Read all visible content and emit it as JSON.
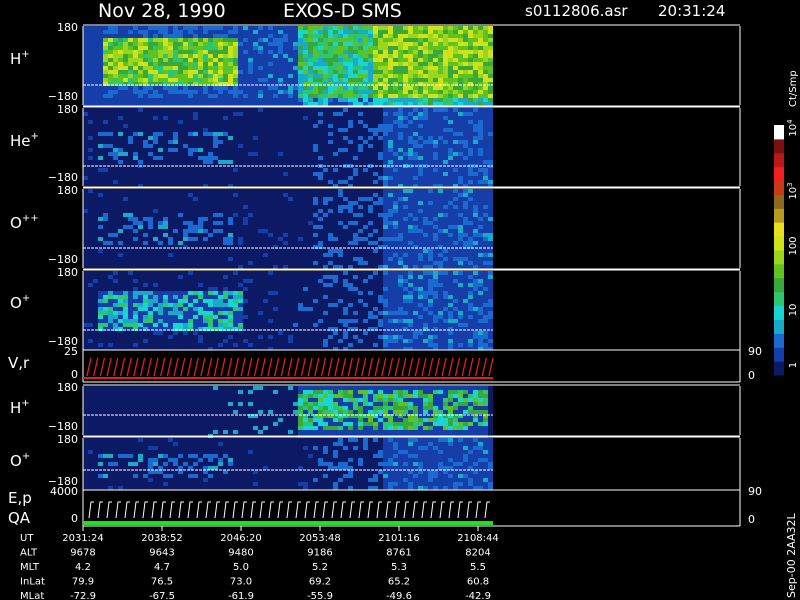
{
  "header": {
    "date": "Nov 28, 1990",
    "instrument": "EXOS-D SMS",
    "file": "s0112806.asr",
    "time": "20:31:24"
  },
  "footer_id": "Sep-00 2AA32L",
  "colors": {
    "background": "#000000",
    "panel_bg": "#102a7a",
    "frame": "#ffffff",
    "velocity_trace": "#e02020",
    "qa_trace": "#20e020"
  },
  "chart_data": {
    "type": "heatmap",
    "x_unit": "UT",
    "panels": [
      {
        "id": "h_plus_1",
        "label": "H",
        "sup": "+",
        "ytop": "180",
        "ybottom": "−180",
        "activity": "strong"
      },
      {
        "id": "he_plus",
        "label": "He",
        "sup": "+",
        "ytop": "180",
        "ybottom": "−180",
        "activity": "weak"
      },
      {
        "id": "o_pp",
        "label": "O",
        "sup": "++",
        "ytop": "180",
        "ybottom": "−180",
        "activity": "weak"
      },
      {
        "id": "o_plus_1",
        "label": "O",
        "sup": "+",
        "ytop": "180",
        "ybottom": "−180",
        "activity": "medium"
      },
      {
        "id": "h_plus_2",
        "label": "H",
        "sup": "+",
        "ytop": "180",
        "ybottom": "−180",
        "activity": "late"
      },
      {
        "id": "o_plus_2",
        "label": "O",
        "sup": "+",
        "ytop": "180",
        "ybottom": "−180",
        "activity": "weak"
      }
    ],
    "line_panels": [
      {
        "id": "vr",
        "label": "V,r",
        "left_ticks": [
          "25",
          "0"
        ],
        "right_ticks": [
          "90",
          "0"
        ]
      },
      {
        "id": "epqa",
        "label_top": "E,p",
        "label_bottom": "QA",
        "left_ticks": [
          "4000",
          "0"
        ],
        "right_ticks": [
          "90",
          "0"
        ]
      }
    ],
    "colorbar": {
      "unit": "Ct/Smp",
      "ticks": [
        {
          "label": "1",
          "sup": ""
        },
        {
          "label": "10",
          "sup": ""
        },
        {
          "label": "100",
          "sup": ""
        },
        {
          "label": "10",
          "sup": "3"
        },
        {
          "label": "10",
          "sup": "4"
        }
      ],
      "colors": [
        "#0c1a66",
        "#163ea8",
        "#1a6ad0",
        "#1ba9c9",
        "#19d5d2",
        "#2fc46e",
        "#39a83a",
        "#5ec221",
        "#9cd61c",
        "#cfe21c",
        "#e6e01c",
        "#b89a22",
        "#8c6a1e",
        "#c83a1a",
        "#f22020",
        "#b81a1a",
        "#7a1010",
        "#ffffff"
      ]
    },
    "ephemeris": {
      "rows": [
        {
          "label": "UT",
          "values": [
            "2031:24",
            "2038:52",
            "2046:20",
            "2053:48",
            "2101:16",
            "2108:44"
          ]
        },
        {
          "label": "ALT",
          "values": [
            "9678",
            "9643",
            "9480",
            "9186",
            "8761",
            "8204"
          ]
        },
        {
          "label": "MLT",
          "values": [
            "4.2",
            "4.7",
            "5.0",
            "5.2",
            "5.3",
            "5.5"
          ]
        },
        {
          "label": "InLat",
          "values": [
            "79.9",
            "76.5",
            "73.0",
            "69.2",
            "65.2",
            "60.8"
          ]
        },
        {
          "label": "MLat",
          "values": [
            "-72.9",
            "-67.5",
            "-61.9",
            "-55.9",
            "-49.6",
            "-42.9"
          ]
        }
      ]
    }
  }
}
